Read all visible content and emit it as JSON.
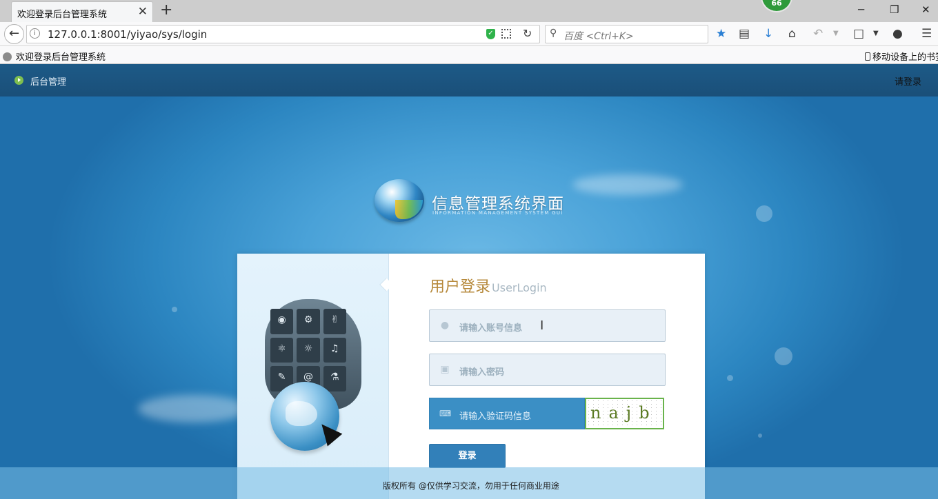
{
  "browser": {
    "tab_title": "欢迎登录后台管理系统",
    "tab_close": "✕",
    "new_tab": "+",
    "addon_badge": "66",
    "window_buttons": [
      "─",
      "❐",
      "✕"
    ],
    "url": "127.0.0.1:8001/yiyao/sys/login",
    "search_placeholder": "百度 <Ctrl+K>",
    "bookmark_left": "欢迎登录后台管理系统",
    "bookmark_right": "移动设备上的书签"
  },
  "page": {
    "topbar_title": "后台管理",
    "topbar_login": "请登录",
    "logo_title": "信息管理系统界面",
    "logo_subtitle": "INFORMATION MANAGEMENT SYSTEM GUI",
    "form": {
      "title": "用户登录",
      "title_en": "UserLogin",
      "username_placeholder": "请输入账号信息",
      "password_placeholder": "请输入密码",
      "captcha_placeholder": "请输入验证码信息",
      "captcha_text": "najb",
      "login_button": "登录"
    },
    "footer": "版权所有 @仅供学习交流，勿用于任何商业用途"
  },
  "colors": {
    "topbar": "#1d5a87",
    "title_gold": "#b6893b",
    "button_blue": "#3280b9",
    "captcha_border": "#69b34b"
  },
  "icons": [
    "close-icon",
    "plus-icon",
    "back-arrow-icon",
    "info-icon",
    "shield-icon",
    "qr-code-icon",
    "reload-icon",
    "search-icon",
    "star-icon",
    "reading-list-icon",
    "download-icon",
    "home-icon",
    "undo-icon",
    "crop-icon",
    "chat-icon",
    "menu-icon",
    "user-icon",
    "lock-icon",
    "keyboard-icon",
    "play-circle-icon"
  ]
}
